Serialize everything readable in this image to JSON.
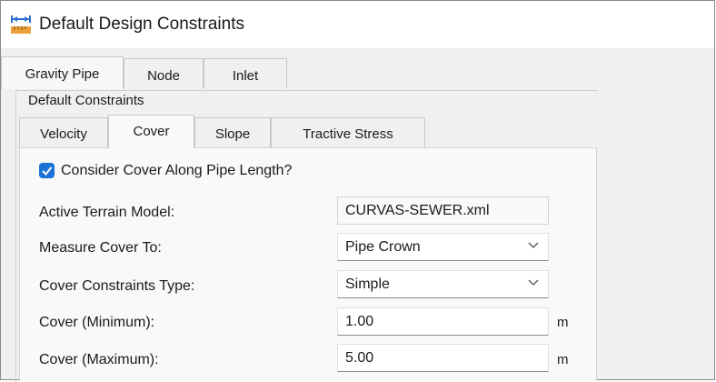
{
  "window": {
    "title": "Default Design Constraints",
    "icon": "dimension-arrows-icon"
  },
  "top_tabs": [
    {
      "label": "Gravity Pipe",
      "active": true
    },
    {
      "label": "Node",
      "active": false
    },
    {
      "label": "Inlet",
      "active": false
    }
  ],
  "group": {
    "label": "Default Constraints"
  },
  "sub_tabs": [
    {
      "label": "Velocity",
      "active": false
    },
    {
      "label": "Cover",
      "active": true
    },
    {
      "label": "Slope",
      "active": false
    },
    {
      "label": "Tractive Stress",
      "active": false
    }
  ],
  "cover": {
    "consider_along_length": {
      "label": "Consider Cover Along Pipe Length?",
      "checked": true
    },
    "terrain_model": {
      "label": "Active Terrain Model:",
      "value": "CURVAS-SEWER.xml"
    },
    "measure_to": {
      "label": "Measure Cover To:",
      "value": "Pipe Crown"
    },
    "constraints_type": {
      "label": "Cover Constraints Type:",
      "value": "Simple"
    },
    "minimum": {
      "label": "Cover (Minimum):",
      "value": "1.00",
      "unit": "m"
    },
    "maximum": {
      "label": "Cover (Maximum):",
      "value": "5.00",
      "unit": "m"
    }
  },
  "colors": {
    "accent": "#1a73d6",
    "background": "#f0f0f0",
    "panel": "#f9f9f9"
  }
}
